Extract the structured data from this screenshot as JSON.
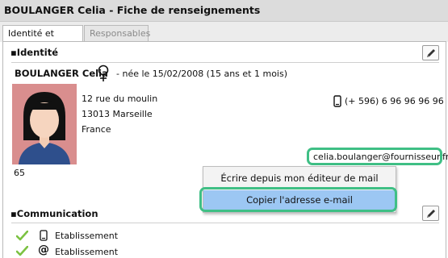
{
  "window": {
    "title": "BOULANGER Celia - Fiche de renseignements"
  },
  "tabs": [
    {
      "label": "Identité et scolarité",
      "active": true
    },
    {
      "label": "Responsables",
      "active": false
    }
  ],
  "identity": {
    "section_title": "Identité",
    "name": "BOULANGER Celia",
    "birth_info": "- née le 15/02/2008 (15 ans et 1 mois)",
    "address_line1": "12 rue du moulin",
    "address_line2": "13013  Marseille",
    "country": "France",
    "phone": "(+ 596) 6 96 96 96 96",
    "email": "celia.boulanger@fournisseur.fr",
    "number_below_photo": "65"
  },
  "context_menu": {
    "items": [
      {
        "label": "Écrire depuis mon éditeur de mail"
      },
      {
        "label": "Copier l'adresse e-mail",
        "highlighted": true
      }
    ]
  },
  "communication": {
    "section_title": "Communication",
    "rows": [
      {
        "icon": "phone-icon",
        "label": "Etablissement"
      },
      {
        "icon": "at-icon",
        "label": "Etablissement"
      }
    ]
  },
  "colors": {
    "highlight_green": "#3fbf85",
    "menu_selected": "#9cc7f3",
    "photo_bg": "#d98e8e",
    "check_green": "#7cc242"
  }
}
